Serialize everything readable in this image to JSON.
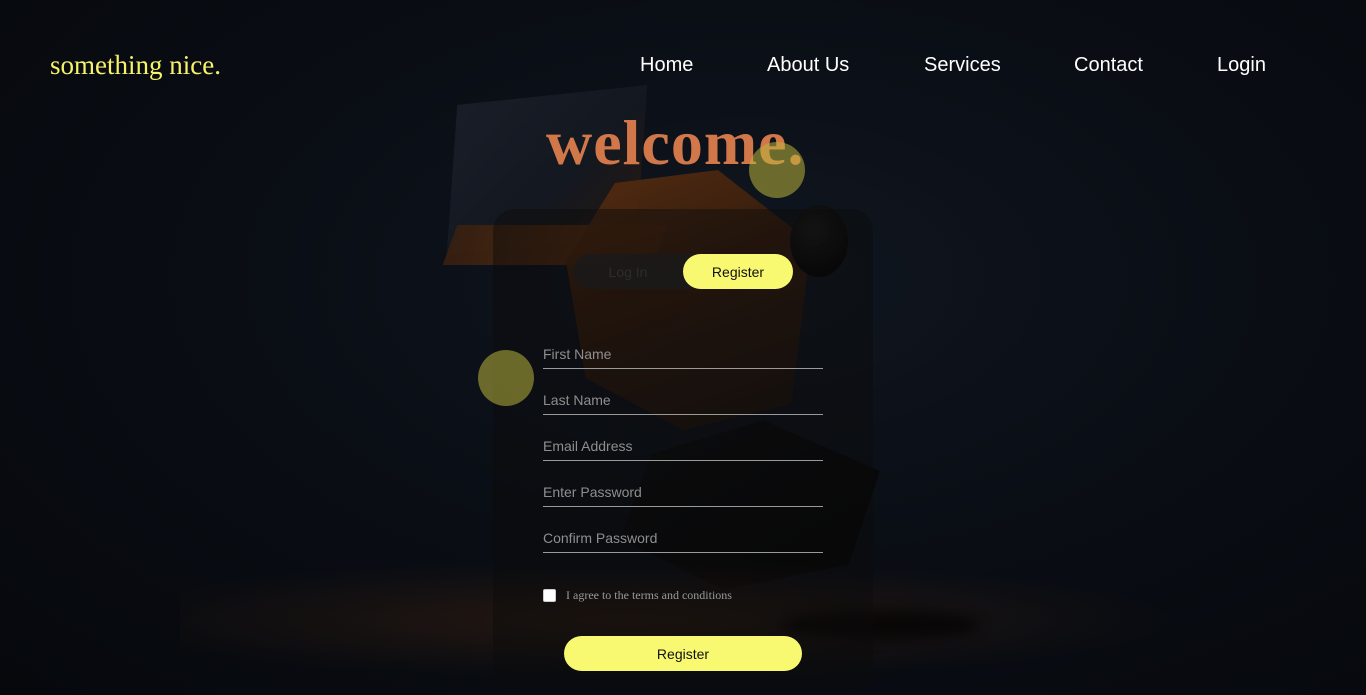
{
  "brand": {
    "name": "something nice."
  },
  "nav": {
    "items": [
      {
        "label": "Home"
      },
      {
        "label": "About Us"
      },
      {
        "label": "Services"
      },
      {
        "label": "Contact"
      },
      {
        "label": "Login"
      }
    ]
  },
  "hero": {
    "title": "welcome."
  },
  "form": {
    "tabs": {
      "login": "Log In",
      "register": "Register",
      "active": "Register"
    },
    "fields": {
      "first_name": {
        "placeholder": "First Name",
        "value": ""
      },
      "last_name": {
        "placeholder": "Last Name",
        "value": ""
      },
      "email": {
        "placeholder": "Email Address",
        "value": ""
      },
      "password": {
        "placeholder": "Enter Password",
        "value": ""
      },
      "confirm_password": {
        "placeholder": "Confirm Password",
        "value": ""
      }
    },
    "terms": {
      "label": "I agree to the terms and conditions",
      "checked": false
    },
    "submit_label": "Register"
  },
  "colors": {
    "accent": "#f9f871",
    "brand_text": "#f6f26a",
    "headline": "#d2774a",
    "background": "#0a0e15"
  }
}
